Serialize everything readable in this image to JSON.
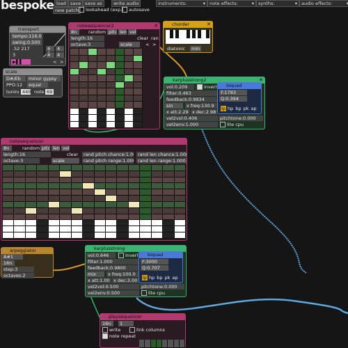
{
  "app": {
    "title": "bespoke",
    "menu": {
      "load": "load",
      "save": "save",
      "save_as": "save as",
      "write_audio": "write audio"
    },
    "new_patch": "new patch",
    "lookahead": "lookahead (exp.)",
    "autosave": "autosave",
    "dropdowns": [
      "instruments:",
      "note effects:",
      "synths:",
      "audio effects:"
    ]
  },
  "transport": {
    "title": "transport",
    "tempo": "tempo:116.0",
    "swing": "swing:0.500",
    "timing": ".52 217",
    "num3": "3",
    "num_l": "4",
    "num_r": "4",
    "num_r2": "4",
    "num_r3": "4"
  },
  "scale": {
    "title": "scale",
    "root": "D#/Eb",
    "mode": "minor gypsy",
    "pps": "PPO:12",
    "equal": "equal",
    "tuning": "tuning",
    "tuning_val": "440",
    "note": "note",
    "note_val": "69"
  },
  "notesequencer2": {
    "title": "notesequencer2",
    "step": "8n",
    "random_label": "random:",
    "random_opts": [
      "pitch",
      "len",
      "vel"
    ],
    "length": "length:16",
    "clear": "clear",
    "ran": "ran",
    "octave": "octave:3",
    "scale": "scale",
    "shift": "<",
    "shift2": ">"
  },
  "chorder": {
    "title": "chorder",
    "mode": "diatonic",
    "submode": "min"
  },
  "karplus2": {
    "title": "karplusstrong2",
    "vol": "vol:0.209",
    "invert": "invert",
    "filter": "filter:0.463",
    "feedback": "feedback:0.9934",
    "source": "sin",
    "xfreq": "x freq:130.9",
    "xatt": "x att:2.29",
    "xdec": "x dec:2.98",
    "vel2vol": "vel2vol:0.406",
    "vel2env": "vel2env:1.000",
    "pitchtone": "pitchtone:0.000",
    "litecpu": "lite cpu"
  },
  "biquad1": {
    "title": "biquad",
    "f": "F:1783",
    "q": "Q:0.394",
    "modes": [
      "lp",
      "hp",
      "bp",
      "pk",
      "ap"
    ]
  },
  "notesequencer": {
    "title": "notesequencer",
    "step": "8n",
    "random_label": "random:",
    "random_opts": [
      "pitch",
      "len",
      "vel"
    ],
    "length": "length:16",
    "clear": "clear",
    "octave": "octave:3",
    "scale": "scale",
    "rand_pitch_chance": "rand pitch chance:1.000",
    "rand_len_chance": "rand len chance:1.000",
    "rand_pitch_range": "rand pitch range:1.000",
    "rand_len_range": "rand len range:1.000"
  },
  "arpeggiator": {
    "title": "arpeggiator",
    "note": "A#1",
    "rate": "16n",
    "step": "step:3",
    "octaves": "octaves:2"
  },
  "karplus1": {
    "title": "karplusstrong",
    "vol": "vol:0.646",
    "invert": "invert",
    "filter": "filter:1.000",
    "feedback": "feedback:0.9800",
    "mix": "mix",
    "xfreq": "x freq:100.0",
    "xatt": "x att:1.00",
    "xdec": "x dec:3.00",
    "vel2vol": "vel2vol:0.500",
    "vel2env": "vel2env:0.500",
    "pitchtone": "pitchtone:0.000",
    "litecpu": "lite cpu"
  },
  "biquad2": {
    "title": "biquad",
    "f": "F:3000",
    "q": "Q:0.707",
    "modes": [
      "lp",
      "hp",
      "bp",
      "pk",
      "ap"
    ]
  },
  "playsequencer": {
    "title": "playsequencer",
    "rate": "16n",
    "num": "1",
    "write": "write",
    "link_columns": "link columns",
    "note_repeat": "note repeat"
  },
  "colors": {
    "notesequencer": "#b03a6e",
    "chorder": "#d4a017",
    "karplus": "#3cb371",
    "biquad": "#4a7ad8",
    "arpeggiator": "#b8862e",
    "transport": "#aaaaaa",
    "cable_blue": "#5fa8e0",
    "cable_orange": "#d99a2a"
  }
}
